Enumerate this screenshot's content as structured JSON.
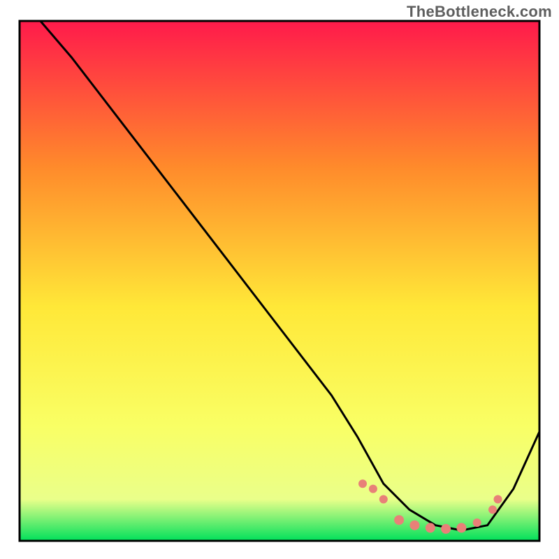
{
  "watermark": "TheBottleneck.com",
  "chart_data": {
    "type": "line",
    "title": "",
    "xlabel": "",
    "ylabel": "",
    "xlim": [
      0,
      100
    ],
    "ylim": [
      0,
      100
    ],
    "grid": false,
    "legend": false,
    "gradient_colors": {
      "top": "#ff1a4b",
      "mid_upper": "#ff8a2b",
      "mid": "#ffe838",
      "mid_lower": "#f9ff65",
      "lower": "#eaff8a",
      "bottom": "#00e05b"
    },
    "series": [
      {
        "name": "bottleneck-curve",
        "stroke": "#000000",
        "x": [
          4,
          10,
          20,
          30,
          40,
          50,
          60,
          65,
          70,
          75,
          80,
          85,
          90,
          95,
          100
        ],
        "y": [
          100,
          93,
          80,
          67,
          54,
          41,
          28,
          20,
          11,
          6,
          3,
          2,
          3,
          10,
          21
        ]
      }
    ],
    "markers": {
      "name": "highlight-points",
      "fill": "#e88078",
      "points": [
        {
          "x": 66,
          "y": 11,
          "r": 6
        },
        {
          "x": 68,
          "y": 10,
          "r": 6
        },
        {
          "x": 70,
          "y": 8,
          "r": 6
        },
        {
          "x": 73,
          "y": 4,
          "r": 7
        },
        {
          "x": 76,
          "y": 3,
          "r": 7
        },
        {
          "x": 79,
          "y": 2.5,
          "r": 7
        },
        {
          "x": 82,
          "y": 2.3,
          "r": 7
        },
        {
          "x": 85,
          "y": 2.5,
          "r": 7
        },
        {
          "x": 88,
          "y": 3.5,
          "r": 6
        },
        {
          "x": 91,
          "y": 6,
          "r": 6
        },
        {
          "x": 92,
          "y": 8,
          "r": 6
        }
      ]
    }
  }
}
